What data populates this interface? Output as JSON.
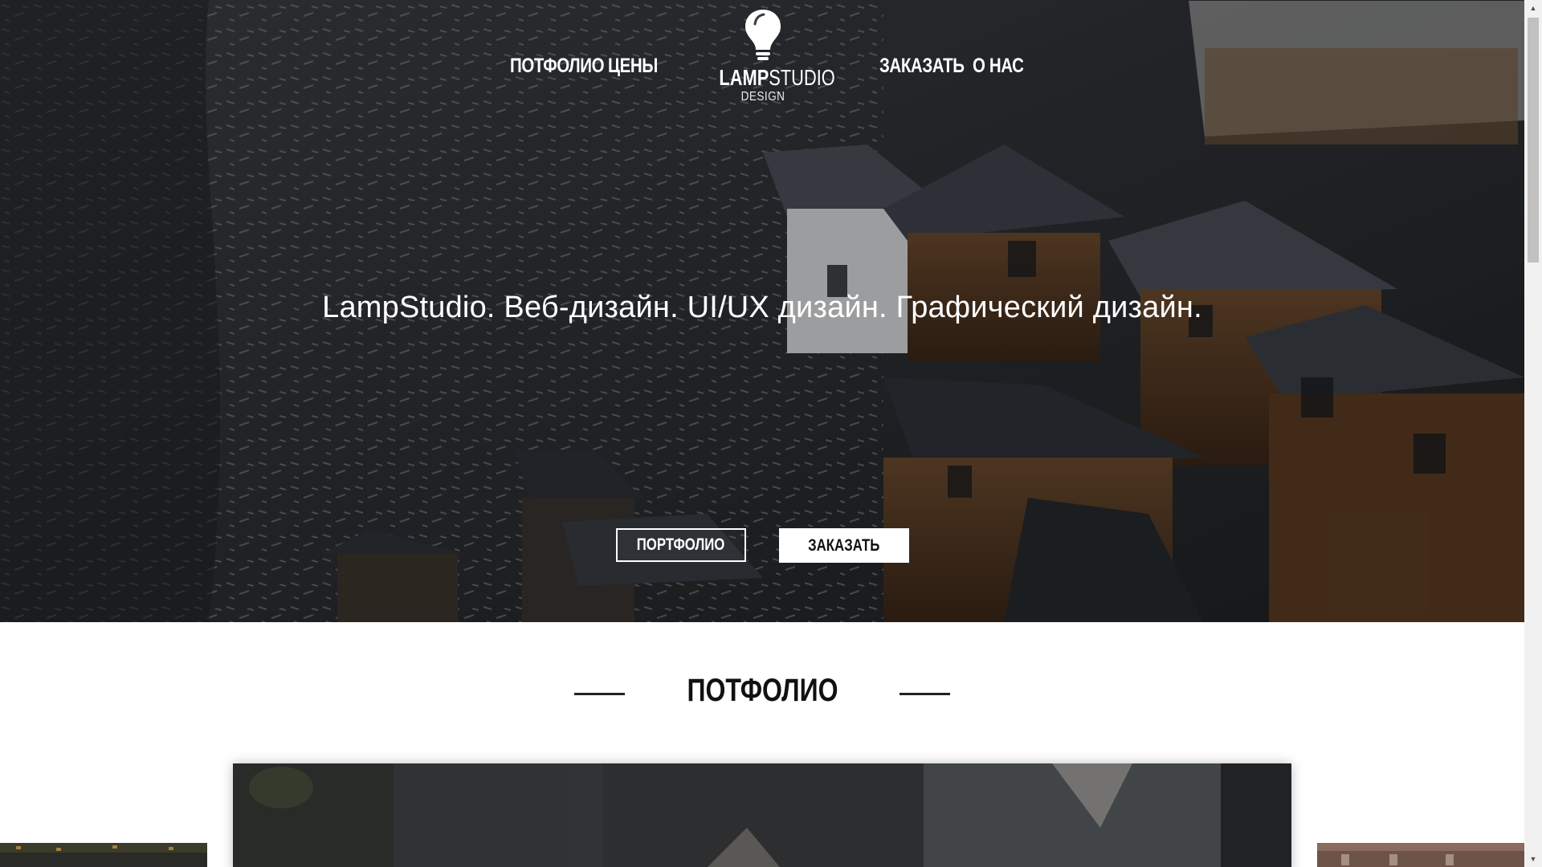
{
  "nav": {
    "portfolio": "ПОТФОЛИО",
    "prices": "ЦЕНЫ",
    "order": "ЗАКАЗАТЬ",
    "about": "О НАС"
  },
  "logo": {
    "icon": "lightbulb-icon",
    "name_bold": "LAMP",
    "name_light": "STUDIO",
    "sub": "DESIGN"
  },
  "hero": {
    "title": "LampStudio. Веб-дизайн. UI/UX дизайн. Графический дизайн.",
    "btn_portfolio": "ПОРТФОЛИО",
    "btn_order": "ЗАКАЗАТЬ"
  },
  "portfolio": {
    "title": "ПОТФОЛИО"
  },
  "colors": {
    "text_light": "#ffffff",
    "text_dark": "#111111",
    "background": "#ffffff"
  }
}
